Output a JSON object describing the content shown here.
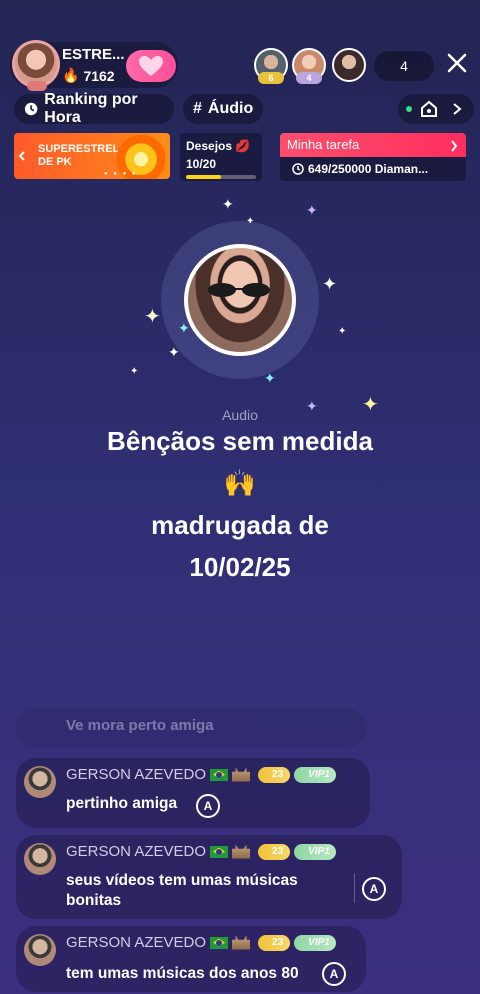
{
  "host": {
    "name": "ESTRE...",
    "score": "7162"
  },
  "viewers": [
    {
      "badge": "6",
      "badge_color": "#e9c23a"
    },
    {
      "badge": "4",
      "badge_color": "#b9a6e0"
    },
    {
      "badge": "",
      "badge_color": ""
    }
  ],
  "viewer_count": "4",
  "chips": {
    "ranking": "Ranking por Hora",
    "audio": "Áudio"
  },
  "pk_banner": {
    "line1": "SUPERESTRELA",
    "line2": "DE PK"
  },
  "desejos": {
    "title": "Desejos",
    "progress": "10/20",
    "fraction": 0.5
  },
  "tarefa": {
    "title": "Minha tarefa",
    "progress": "649/250000 Diaman..."
  },
  "room": {
    "audio_label": "Audio",
    "title_lines": [
      "Bênçãos sem medida",
      "🙌",
      "madrugada de",
      "10/02/25"
    ]
  },
  "chat": {
    "faded": "Ve mora perto amiga",
    "messages": [
      {
        "user": "GERSON AZEVEDO",
        "level": "23",
        "vip": "VIP1",
        "text": "pertinho amiga"
      },
      {
        "user": "GERSON AZEVEDO",
        "level": "23",
        "vip": "VIP1",
        "text": "seus vídeos tem umas músicas bonitas"
      },
      {
        "user": "GERSON AZEVEDO",
        "level": "23",
        "vip": "VIP1",
        "text": "tem umas músicas dos anos 80"
      }
    ]
  }
}
